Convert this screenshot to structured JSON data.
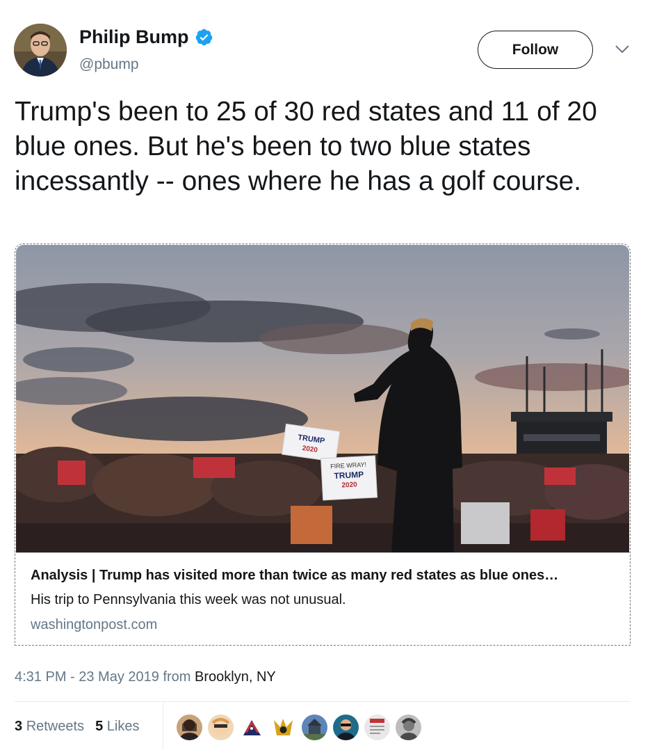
{
  "author": {
    "name": "Philip Bump",
    "handle": "@pbump",
    "avatar_icon": "profile-photo"
  },
  "follow_label": "Follow",
  "tweet_text": "Trump's been to 25 of 30 red states and 11 of 20 blue ones. But he's been to two blue states incessantly -- ones where he has a golf course.",
  "card": {
    "title": "Analysis | Trump has visited more than twice as many red states as blue ones…",
    "description": "His trip to Pennsylvania this week was not unusual.",
    "domain": "washingtonpost.com",
    "image_signs": [
      "TRUMP 2020",
      "FIRE WRAY! TRUMP 2020"
    ]
  },
  "meta": {
    "timestamp": "4:31 PM - 23 May 2019",
    "from_label": "from",
    "location": "Brooklyn, NY"
  },
  "stats": {
    "retweets_count": "3",
    "retweets_label": "Retweets",
    "likes_count": "5",
    "likes_label": "Likes"
  },
  "colors": {
    "verified_blue": "#1da1f2",
    "secondary_text": "#657786"
  }
}
